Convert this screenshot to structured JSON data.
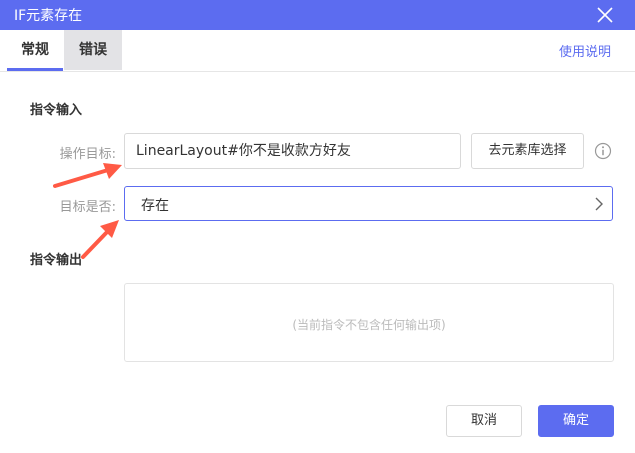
{
  "window": {
    "title": "IF元素存在",
    "close_icon": "close-icon"
  },
  "tabs": [
    {
      "label": "常规",
      "active": true
    },
    {
      "label": "错误",
      "active": false
    }
  ],
  "help_link": "使用说明",
  "input_section": {
    "title": "指令输入",
    "target": {
      "label": "操作目标:",
      "value": "LinearLayout#你不是收款方好友",
      "button": "去元素库选择",
      "info_icon": "info-icon"
    },
    "exists": {
      "label": "目标是否:",
      "value": "存在",
      "chevron_icon": "chevron-right-icon"
    }
  },
  "output_section": {
    "title": "指令输出",
    "empty_text": "(当前指令不包含任何输出项)"
  },
  "footer": {
    "cancel": "取消",
    "confirm": "确定"
  },
  "colors": {
    "accent": "#5c6cf0",
    "annotation_arrow": "#ff5a45"
  }
}
